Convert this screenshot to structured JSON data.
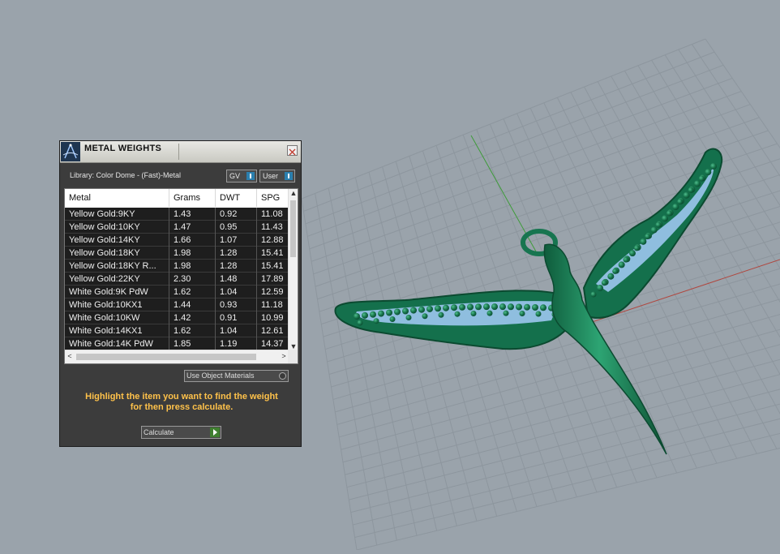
{
  "panel": {
    "title": "METAL WEIGHTS",
    "library": "Library: Color Dome - (Fast)-Metal",
    "gv_label": "GV",
    "user_label": "User",
    "use_object_materials": "Use Object Materials",
    "hint_line1": "Highlight the item you want to find the weight",
    "hint_line2": "for then press calculate.",
    "calculate_label": "Calculate"
  },
  "table": {
    "headers": [
      "Metal",
      "Grams",
      "DWT",
      "SPG"
    ],
    "rows": [
      [
        "Yellow Gold:9KY",
        "1.43",
        "0.92",
        "11.08"
      ],
      [
        "Yellow Gold:10KY",
        "1.47",
        "0.95",
        "11.43"
      ],
      [
        "Yellow Gold:14KY",
        "1.66",
        "1.07",
        "12.88"
      ],
      [
        "Yellow Gold:18KY",
        "1.98",
        "1.28",
        "15.41"
      ],
      [
        "Yellow Gold:18KY R...",
        "1.98",
        "1.28",
        "15.41"
      ],
      [
        "Yellow Gold:22KY",
        "2.30",
        "1.48",
        "17.89"
      ],
      [
        "White Gold:9K PdW",
        "1.62",
        "1.04",
        "12.59"
      ],
      [
        "White Gold:10KX1",
        "1.44",
        "0.93",
        "11.18"
      ],
      [
        "White Gold:10KW",
        "1.42",
        "0.91",
        "10.99"
      ],
      [
        "White Gold:14KX1",
        "1.62",
        "1.04",
        "12.61"
      ],
      [
        "White Gold:14K PdW",
        "1.85",
        "1.19",
        "14.37"
      ]
    ]
  },
  "icons": {
    "logo": "compass-logo-icon",
    "close": "close-icon",
    "toggle": "toggle-icon",
    "radio": "radio-icon",
    "go": "play-arrow-icon"
  },
  "colors": {
    "viewport_bg": "#9aa3ab",
    "grid": "#8d969e",
    "model_green": "#1d7a55",
    "gem_blue": "#9cc7f0",
    "hint_text": "#ffc24a",
    "panel_bg": "#3c3c3c"
  }
}
